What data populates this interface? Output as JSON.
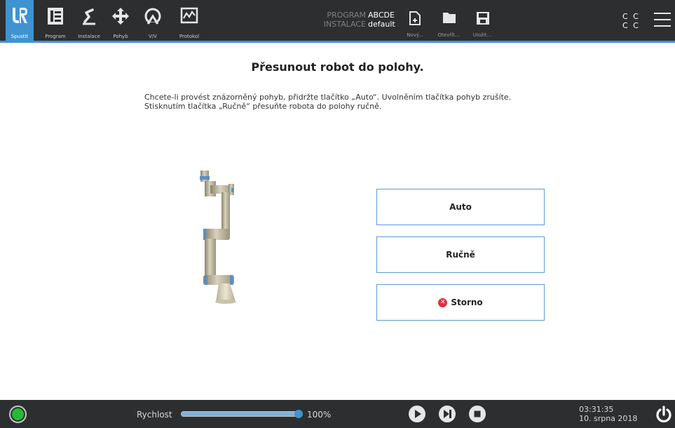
{
  "nav": {
    "items": [
      {
        "label": "Spustit",
        "icon": "ur-logo-icon"
      },
      {
        "label": "Program",
        "icon": "program-tree-icon"
      },
      {
        "label": "Instalace",
        "icon": "installation-robot-icon"
      },
      {
        "label": "Pohyb",
        "icon": "move-arrows-icon"
      },
      {
        "label": "V/V",
        "icon": "io-gauge-icon"
      },
      {
        "label": "Protokol",
        "icon": "log-chart-icon"
      }
    ]
  },
  "program_info": {
    "program_key": "PROGRAM",
    "program_value": "ABCDE",
    "installation_key": "INSTALACE",
    "installation_value": "default"
  },
  "file_buttons": {
    "new_label": "Nový...",
    "open_label": "Otevřít...",
    "save_label": "Uložit..."
  },
  "mode_indicator": {
    "row1": "C C",
    "row2": "C C"
  },
  "main": {
    "title": "Přesunout robot do polohy.",
    "instruction_line1": "Chcete-li provést znázorněný pohyb, přidržte tlačítko „Auto“. Uvolněním tlačítka pohyb zrušíte.",
    "instruction_line2": "Stisknutím tlačítka „Ručně“ přesuňte robota do polohy ručně.",
    "auto_label": "Auto",
    "manual_label": "Ručně",
    "cancel_label": "Storno"
  },
  "footer": {
    "speed_label": "Rychlost",
    "speed_percent": 100,
    "speed_text": "100%",
    "time": "03:31:35",
    "date": "10. srpna 2018"
  },
  "colors": {
    "bar_background": "#2d2e30",
    "accent_blue": "#3f93d1",
    "button_border": "#5a9bd5",
    "status_green": "#22bb33",
    "cancel_red": "#e0303c"
  }
}
